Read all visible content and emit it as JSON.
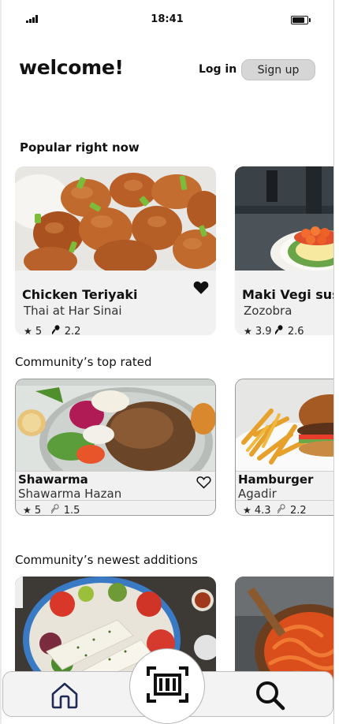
{
  "status": {
    "time": "18:41",
    "signal_icon": "signal-icon",
    "battery_icon": "battery-icon"
  },
  "header": {
    "title": "welcome!",
    "login_label": "Log in",
    "signup_label": "Sign up"
  },
  "sections": {
    "popular": {
      "title": "Popular right now",
      "cards": [
        {
          "dish": "Chicken Teriyaki",
          "place": "Thai at Har Sinai",
          "rating": "5",
          "score": "2.2",
          "favorited": true
        },
        {
          "dish": "Maki Vegi sushi",
          "place": "Zozobra",
          "rating": "3.9",
          "score": "2.6"
        }
      ]
    },
    "top_rated": {
      "title": "Community’s top rated",
      "cards": [
        {
          "dish": "Shawarma",
          "place": "Shawarma Hazan",
          "rating": "5",
          "score": "1.5",
          "favorited": false
        },
        {
          "dish": "Hamburger",
          "place": "Agadir",
          "rating": "4.3",
          "score": "2.2"
        }
      ]
    },
    "newest": {
      "title": "Community’s newest additions"
    }
  },
  "nav": {
    "home_icon": "home-icon",
    "scan_icon": "barcode-scan-icon",
    "search_icon": "search-icon"
  },
  "symbols": {
    "star": "★"
  }
}
